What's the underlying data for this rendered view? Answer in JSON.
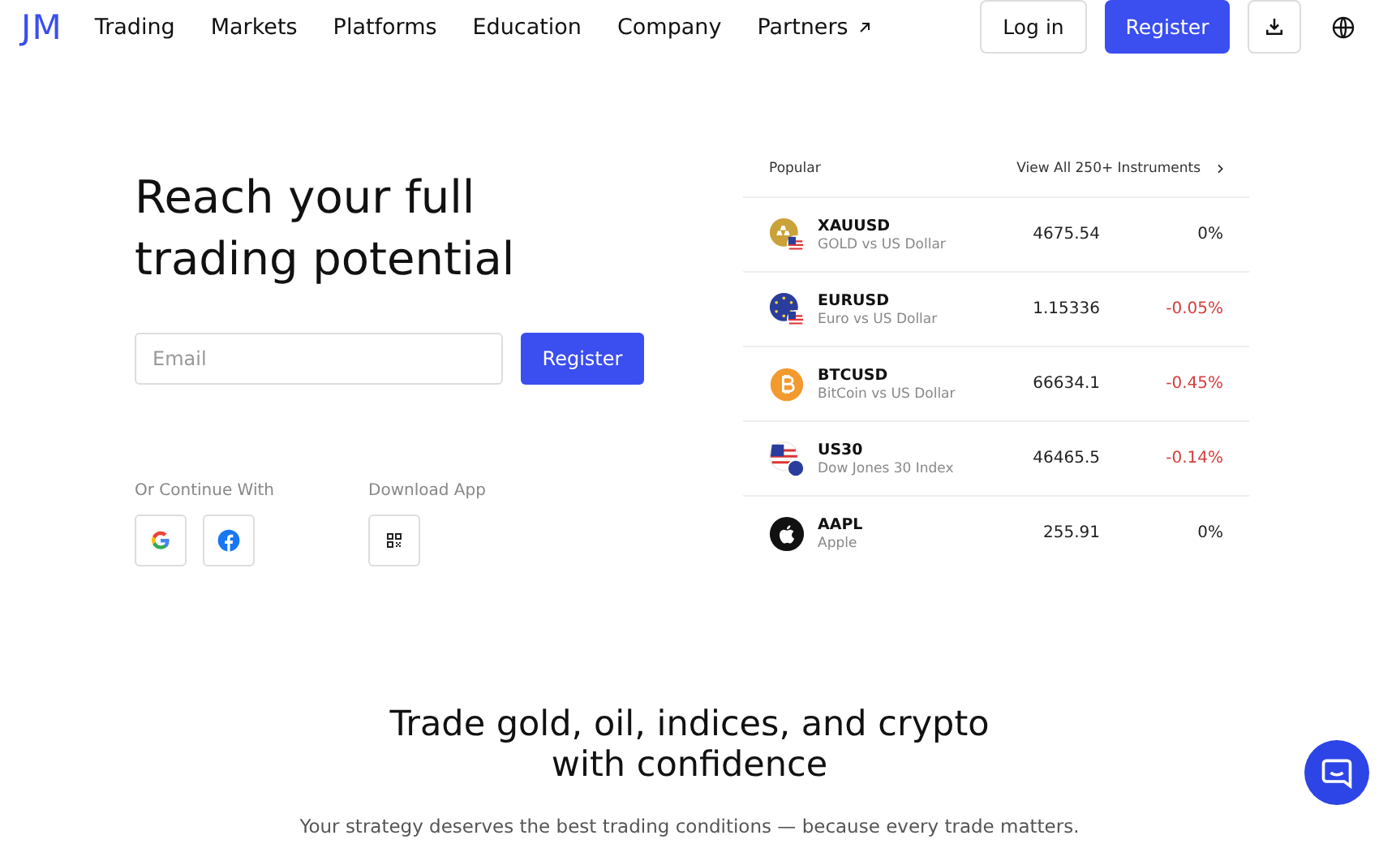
{
  "header": {
    "logo": "JM",
    "nav": [
      {
        "label": "Trading",
        "external": false
      },
      {
        "label": "Markets",
        "external": false
      },
      {
        "label": "Platforms",
        "external": false
      },
      {
        "label": "Education",
        "external": false
      },
      {
        "label": "Company",
        "external": false
      },
      {
        "label": "Partners",
        "external": true
      }
    ],
    "login": "Log in",
    "register": "Register"
  },
  "hero": {
    "title": "Reach your full trading potential",
    "email": {
      "placeholder": "Email"
    },
    "register": "Register",
    "continue_label": "Or Continue With",
    "download_label": "Download App"
  },
  "instruments": {
    "heading": "Popular",
    "view_all": "View All 250+ Instruments",
    "rows": [
      {
        "kind": "gold",
        "symbol": "XAUUSD",
        "name": "GOLD vs US Dollar",
        "price": "4675.54",
        "change": "0%",
        "negative": false
      },
      {
        "kind": "euro",
        "symbol": "EURUSD",
        "name": "Euro vs US Dollar",
        "price": "1.15336",
        "change": "-0.05%",
        "negative": true
      },
      {
        "kind": "bitcoin",
        "symbol": "BTCUSD",
        "name": "BitCoin vs US Dollar",
        "price": "66634.1",
        "change": "-0.45%",
        "negative": true
      },
      {
        "kind": "index",
        "symbol": "US30",
        "name": "Dow Jones 30 Index",
        "price": "46465.5",
        "change": "-0.14%",
        "negative": true
      },
      {
        "kind": "apple",
        "symbol": "AAPL",
        "name": "Apple",
        "price": "255.91",
        "change": "0%",
        "negative": false
      }
    ]
  },
  "feature": {
    "title": "Trade gold, oil, indices, and crypto with confidence",
    "subtitle": "Your strategy deserves the best trading conditions — because every trade matters."
  }
}
